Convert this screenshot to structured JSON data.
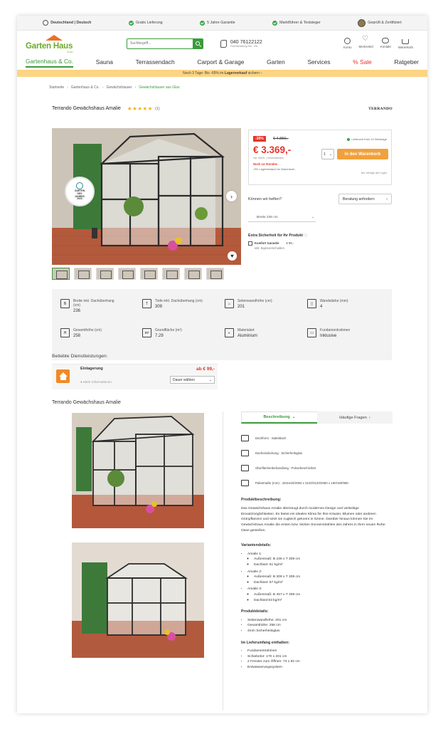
{
  "topbar": {
    "lang": "Deutschland | Deutsch",
    "items": [
      "Gratis Lieferung",
      "5 Jahre Garantie",
      "Marktführer & Testsieger",
      "Geprüft & Zertifiziert"
    ]
  },
  "header": {
    "logo_text": "Garten Haus",
    "logo_sub": "GmbH",
    "search_placeholder": "Suchbegriff...",
    "phone": "040 76122122",
    "phone_hours": "Fachberatung Mo - Sa",
    "icons": [
      {
        "label": "Konto",
        "icon": "account-icon"
      },
      {
        "label": "Merkzettel",
        "icon": "heart-icon"
      },
      {
        "label": "Kontakt",
        "icon": "chat-icon"
      },
      {
        "label": "Warenkorb",
        "icon": "cart-icon"
      }
    ]
  },
  "nav": [
    "Gartenhaus & Co.",
    "Sauna",
    "Terrassendach",
    "Carport & Garage",
    "Garten",
    "Services",
    "% Sale",
    "Ratgeber"
  ],
  "promo": {
    "text": "Noch 3 Tage: Bis -65% im",
    "bold": "Lagerverkauf",
    "after": "sichern ›"
  },
  "breadcrumb": [
    "Startseite",
    "Gartenhaus & Co.",
    "Gewächshäuser",
    "Gewächshäuser aus Glas"
  ],
  "product": {
    "title": "Terrando Gewächshaus Amalie",
    "stars": "★★★★★",
    "rating_count": "(1)",
    "brand": "TERRANDO",
    "badge": [
      "GARTEN",
      "DES",
      "JAHRES",
      "2023"
    ]
  },
  "buy": {
    "discount": "-30%",
    "old_price": "€ 4.859,-",
    "price": "€ 3.369,-",
    "vat": "inkl. MwSt. | Versandkosten",
    "delivery": "Lieferzeit 5 bis 10 Werktage",
    "qty": "1",
    "cart_label": "In den Warenkorb",
    "stock": "Noch 14 Stunden",
    "stock_sub": "-5% Lagerbestand im Warenkorb",
    "stock_note": "Nur wenige auf Lager",
    "help_q": "Können wir helfen?",
    "consult": "Beratung anfordern",
    "variant": "Breite 236 cm",
    "extra_title": "Extra Sicherheit für Ihr Produkt",
    "opt_name": "Komfort Garantie",
    "opt_price": "€ 99,-",
    "opt_sub": "inkl. Eigenverschulden"
  },
  "specs": [
    {
      "label": "Breite inkl. Dachüberhang (cm)",
      "value": "236",
      "icon": "B"
    },
    {
      "label": "Tiefe inkl. Dachüberhang (cm)",
      "value": "309",
      "icon": "T"
    },
    {
      "label": "Seitenwandhöhe (cm)",
      "value": "201",
      "icon": "⌂"
    },
    {
      "label": "Wandstärke (mm)",
      "value": "4",
      "icon": "▯"
    },
    {
      "label": "Gesamthöhe (cm)",
      "value": "258",
      "icon": "H"
    },
    {
      "label": "Grundfläche (m²)",
      "value": "7.29",
      "icon": "m²"
    },
    {
      "label": "Materialart",
      "value": "Aluminium",
      "icon": "◐"
    },
    {
      "label": "Fundamentrahmen",
      "value": "Inklusive",
      "icon": "▭"
    }
  ],
  "services": {
    "heading": "Beliebte Dienstleistungen:",
    "name": "Einlagerung",
    "price": "ab € 99,-",
    "more": "Mehr Informationen",
    "duration": "Dauer wählen"
  },
  "section_title": "Terrando Gewächshaus Amalie",
  "tabs": [
    {
      "label": "Beschreibung",
      "active": true
    },
    {
      "label": "Häufige Fragen",
      "active": false
    }
  ],
  "features": [
    "Dachform : Satteldach",
    "Dacheindeckung : Sicherheitsglas",
    "Oberflächenbehandlung : Pulverbeschichtet",
    "Paketmaße (mm) : 420x420/2050 x 3120/3120/2050 x 180/180/980"
  ],
  "description": {
    "h1": "Produktbeschreibung:",
    "p1": "Das Gewächshaus Amalie überzeugt durch modernes Design und vielseitige Einsatzmöglichkeiten. Es bietet ein ideales Klima für Ihre Kräuter, Blumen oder anderen Grünpflanzen und setzt sie zugleich gekonnt in Szene. Darüber hinaus können Sie im Gewächshaus Amalie die ersten bzw. letzten Sonnenstrahlen des Jahres in Ihrer neuen Ruhe-Oase genießen.",
    "h2": "Variantendetails:",
    "variants": [
      {
        "name": "Amalie 1:",
        "size": "Außenmaß: B 236 x T 309 cm",
        "load": "Dachlast: 61 kg/m²"
      },
      {
        "name": "Amalie 2:",
        "size": "Außenmaß: B 309 x T 309 cm",
        "load": "Dachlast: 57 kg/m²"
      },
      {
        "name": "Amalie 3:",
        "size": "Außenmaß: B 457 x T 309 cm",
        "load": "Dachlast:53 kg/m²"
      }
    ],
    "h3": "Produktdetails:",
    "details": [
      "Seitenwandhöhe: 201 cm",
      "Gesamthöhe: 258 cm",
      "4mm Sicherheitsglas"
    ],
    "h4": "Im Lieferumfang enthalten:",
    "included": [
      "Fundamentrahmen",
      "Schiebetür: 170 x 201 cm",
      "2 Fenster zum Öffnen: 73 x 82 cm",
      "Entwässerungssystem"
    ]
  }
}
